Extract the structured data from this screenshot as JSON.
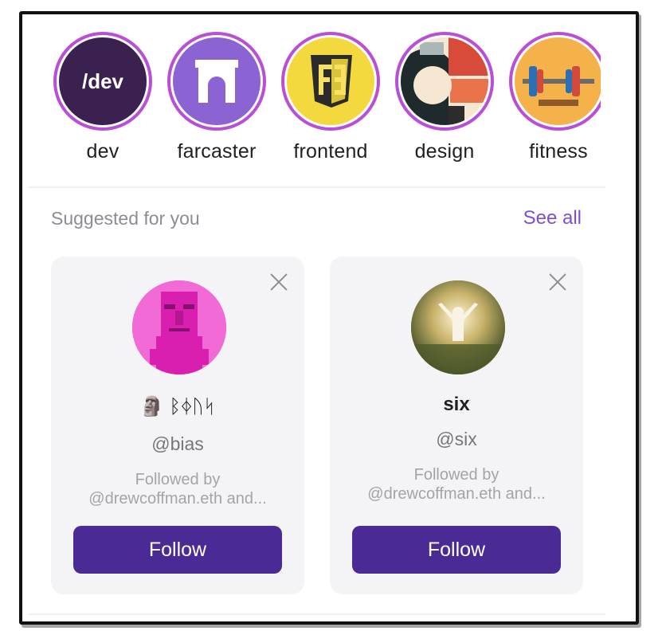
{
  "channels": [
    {
      "label": "dev",
      "avatar_text": "/dev"
    },
    {
      "label": "farcaster"
    },
    {
      "label": "frontend"
    },
    {
      "label": "design"
    },
    {
      "label": "fitness"
    }
  ],
  "suggestions": {
    "title": "Suggested for you",
    "see_all": "See all",
    "cards": [
      {
        "display_name": "🗿 ᛒᛄᚢᛋ",
        "username": "@bias",
        "followed_by_line1": "Followed by",
        "followed_by_line2": "@drewcoffman.eth and...",
        "follow_label": "Follow"
      },
      {
        "display_name": "six",
        "username": "@six",
        "followed_by_line1": "Followed by",
        "followed_by_line2": "@drewcoffman.eth and...",
        "follow_label": "Follow"
      }
    ]
  },
  "colors": {
    "ring": "#b94fd6",
    "accent": "#7c4fd4",
    "button": "#4a2a95",
    "card_bg": "#f4f4f6"
  }
}
